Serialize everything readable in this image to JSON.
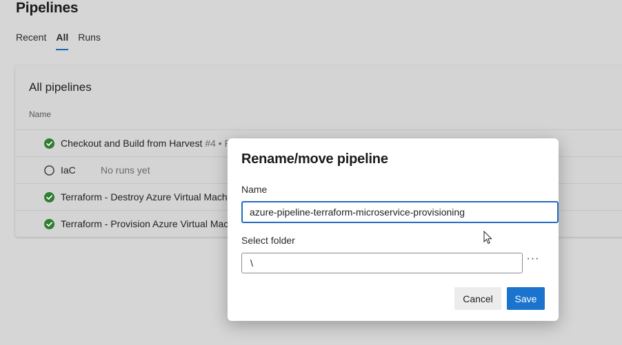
{
  "page": {
    "title": "Pipelines",
    "tabs": [
      {
        "label": "Recent",
        "active": false
      },
      {
        "label": "All",
        "active": true
      },
      {
        "label": "Runs",
        "active": false
      }
    ]
  },
  "card": {
    "title": "All pipelines",
    "column_header": "Name",
    "rows": [
      {
        "name": "Checkout and Build from Harvest",
        "meta": "#4 • F",
        "status": "success-icon"
      },
      {
        "name": "IaC",
        "sub": "No runs yet",
        "status": "not-run-icon"
      },
      {
        "name": "Terraform - Destroy Azure Virtual Mach",
        "status": "success-icon"
      },
      {
        "name": "Terraform - Provision Azure Virtual Mac",
        "status": "success-icon"
      }
    ]
  },
  "dialog": {
    "title": "Rename/move pipeline",
    "name_label": "Name",
    "name_value": "azure-pipeline-terraform-microservice-provisioning",
    "folder_label": "Select folder",
    "folder_value": "\\",
    "more_label": "···",
    "cancel_label": "Cancel",
    "save_label": "Save"
  },
  "colors": {
    "accent": "#1a73cd",
    "success": "#2e7d32",
    "background_dimmed": "#d6d6d6"
  }
}
